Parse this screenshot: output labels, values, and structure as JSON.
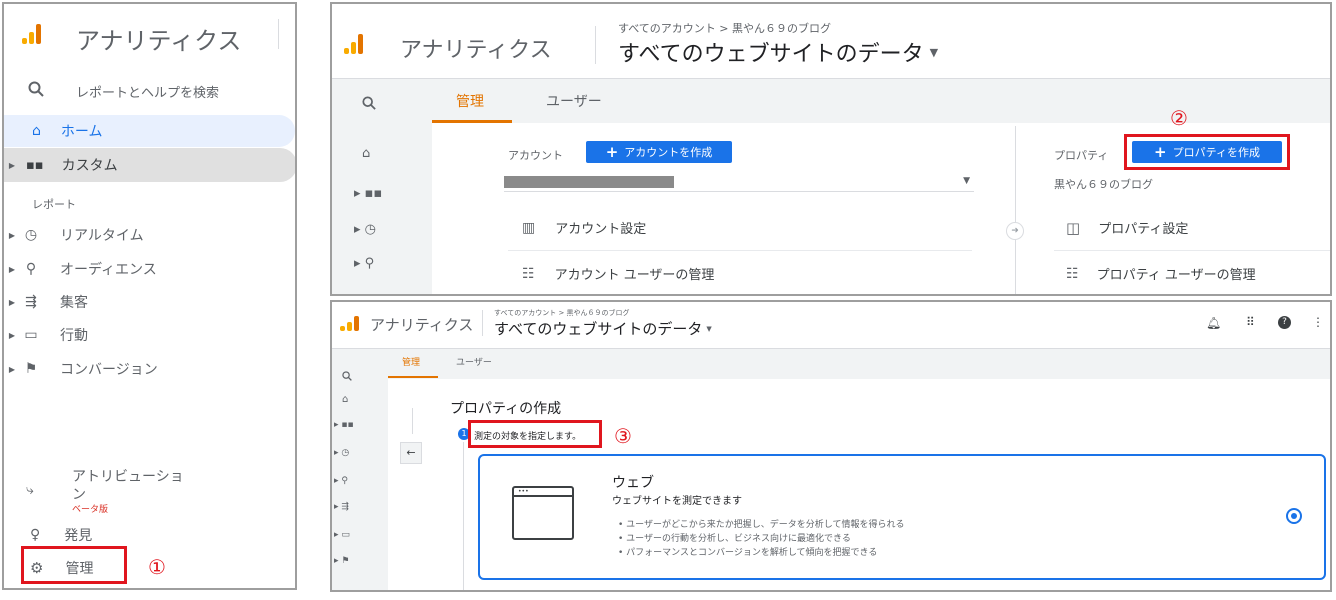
{
  "app_title": "アナリティクス",
  "left_panel": {
    "search_label": "レポートとヘルプを検索",
    "home": "ホーム",
    "custom": "カスタム",
    "reports_section": "レポート",
    "realtime": "リアルタイム",
    "audience": "オーディエンス",
    "acquisition": "集客",
    "behavior": "行動",
    "conversion": "コンバージョン",
    "attribution_line1": "アトリビューショ",
    "attribution_line2": "ン",
    "beta": "ベータ版",
    "discover": "発見",
    "admin": "管理",
    "marker": "①"
  },
  "top_panel": {
    "breadcrumb": "すべてのアカウント > 黒やん６９のブログ",
    "view_title": "すべてのウェブサイトのデータ",
    "tab_admin": "管理",
    "tab_user": "ユーザー",
    "account_label": "アカウント",
    "create_account": "アカウントを作成",
    "property_label": "プロパティ",
    "create_property": "プロパティを作成",
    "property_name": "黒やん６９のブログ",
    "account_settings": "アカウント設定",
    "account_user_mgmt": "アカウント ユーザーの管理",
    "property_settings": "プロパティ設定",
    "property_user_mgmt": "プロパティ ユーザーの管理",
    "marker": "②"
  },
  "bottom_panel": {
    "breadcrumb": "すべてのアカウント > 黒やん６９のブログ",
    "view_title": "すべてのウェブサイトのデータ",
    "tab_admin": "管理",
    "tab_user": "ユーザー",
    "heading": "プロパティの作成",
    "step_num": "1",
    "step_label": "測定の対象を指定します。",
    "marker": "③",
    "card_title": "ウェブ",
    "card_subtitle": "ウェブサイトを測定できます",
    "bullets": [
      "ユーザーがどこから来たか把握し、データを分析して情報を得られる",
      "ユーザーの行動を分析し、ビジネス向けに最適化できる",
      "パフォーマンスとコンバージョンを解析して傾向を把握できる"
    ]
  }
}
